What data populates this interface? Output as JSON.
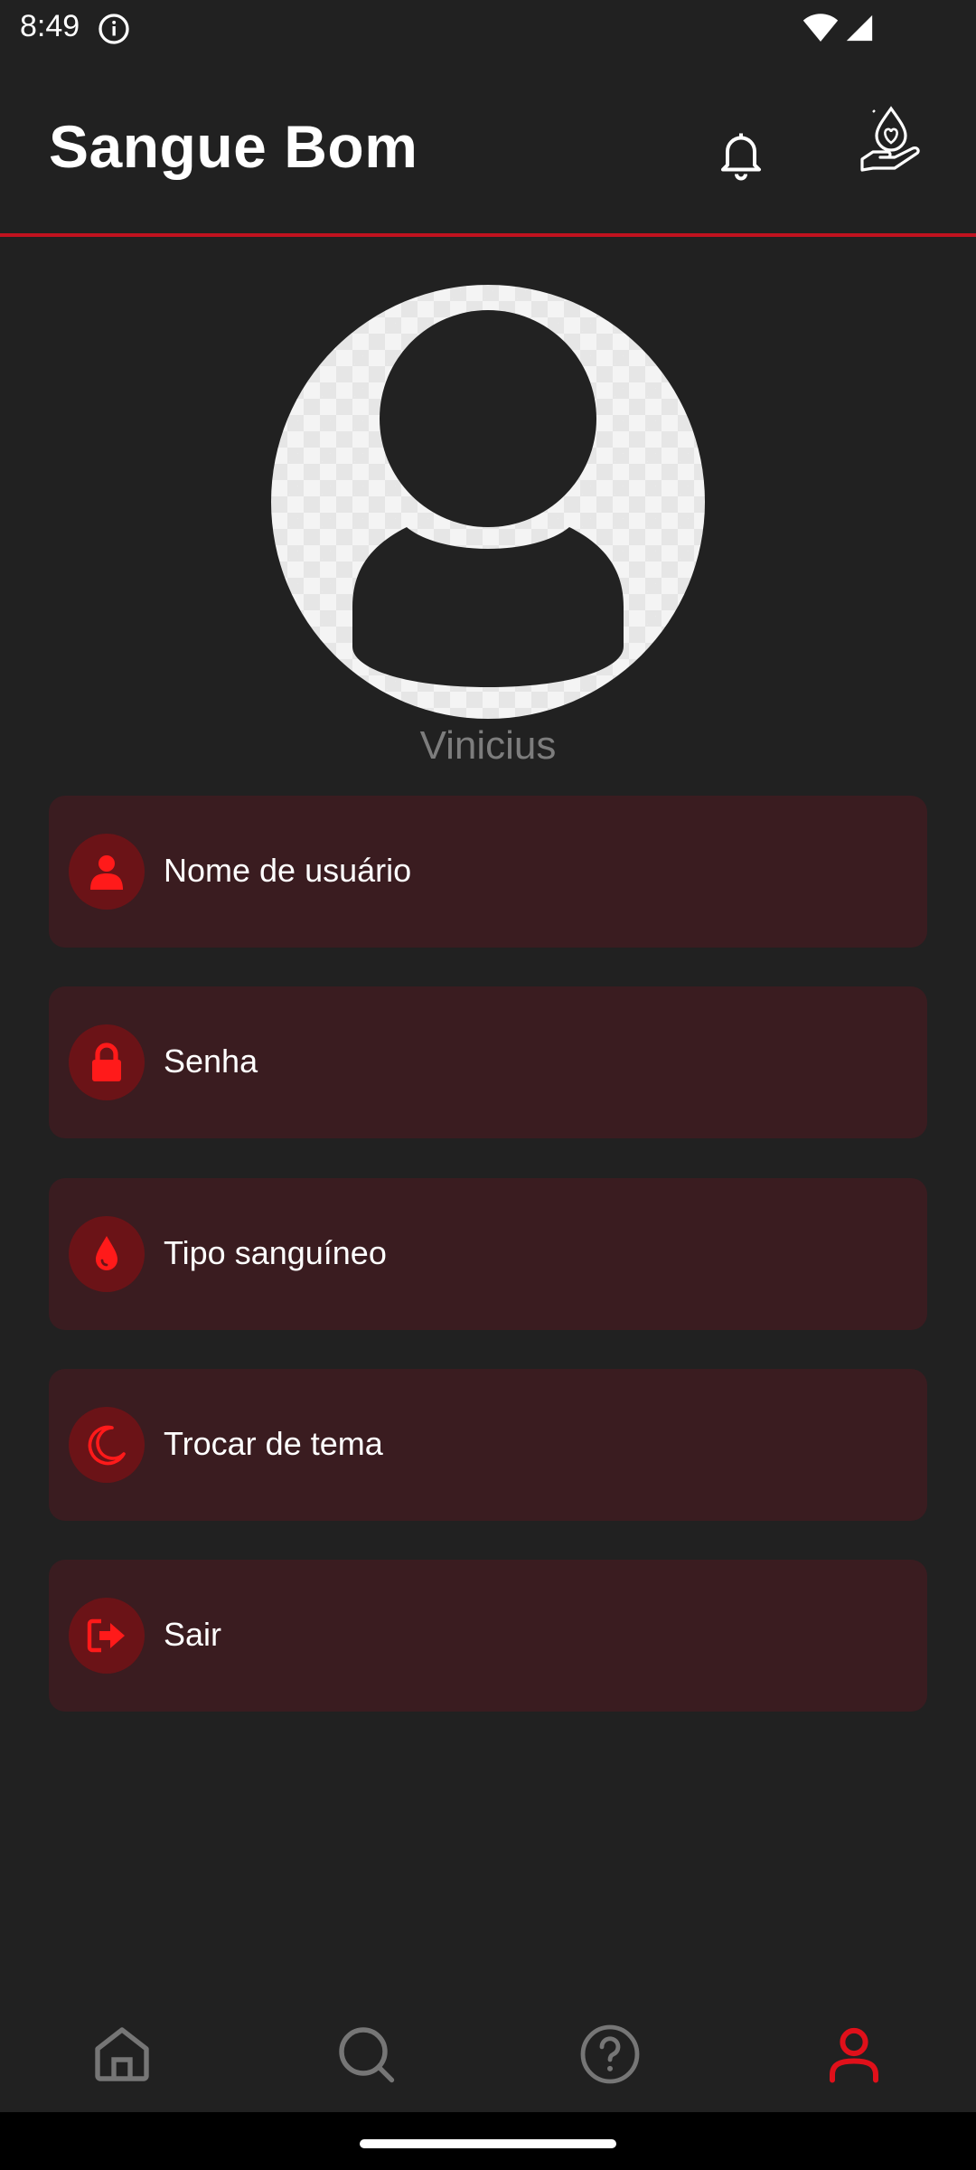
{
  "status_bar": {
    "time": "8:49"
  },
  "app_bar": {
    "title": "Sangue Bom"
  },
  "profile": {
    "name": "Vinicius"
  },
  "menu": {
    "items": [
      {
        "label": "Nome de usuário",
        "icon": "person-icon"
      },
      {
        "label": "Senha",
        "icon": "lock-icon"
      },
      {
        "label": "Tipo sanguíneo",
        "icon": "blood-drop-icon"
      },
      {
        "label": "Trocar de tema",
        "icon": "moon-icon"
      },
      {
        "label": "Sair",
        "icon": "logout-icon"
      }
    ]
  },
  "bottom_nav": {
    "items": [
      {
        "icon": "home-icon",
        "active": false
      },
      {
        "icon": "search-icon",
        "active": false
      },
      {
        "icon": "help-icon",
        "active": false
      },
      {
        "icon": "profile-icon",
        "active": true
      }
    ]
  },
  "colors": {
    "background": "#212121",
    "accent": "#e0101a",
    "card": "#3a1c20",
    "icon_circle": "#6b1317",
    "muted_text": "#7d7d7d"
  }
}
